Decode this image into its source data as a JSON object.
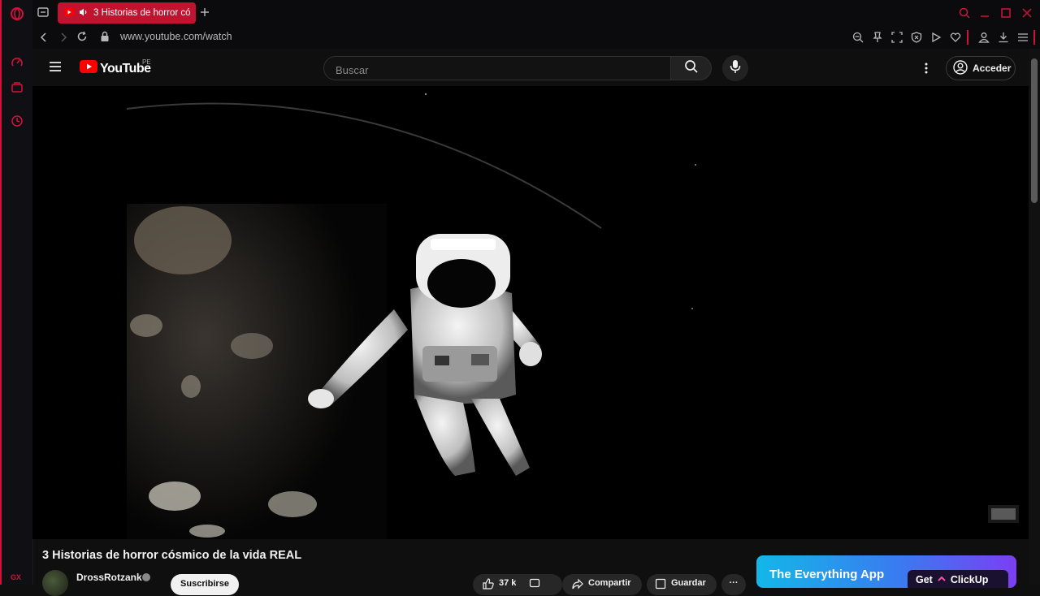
{
  "browser": {
    "tab_title": "3 Historias de horror có",
    "url": "www.youtube.com/watch",
    "brand": "GX",
    "accent_color": "#d1123a"
  },
  "header": {
    "logo_text": "YouTube",
    "region": "PE",
    "search_placeholder": "Buscar",
    "signin_label": "Acceder"
  },
  "video": {
    "title": "3 Historias de horror cósmico de la vida REAL",
    "channel": "DrossRotzank",
    "subscribe_label": "Suscribirse",
    "likes": "37 k",
    "share_label": "Compartir",
    "save_label": "Guardar",
    "more_label": "···"
  },
  "ad": {
    "headline": "The Everything App",
    "cta_prefix": "Get",
    "cta_brand": "ClickUp"
  },
  "icons": {
    "sidebar": [
      "speed-dial-icon",
      "bag-icon",
      "history-icon"
    ],
    "toolbar": [
      "zoom-icon",
      "pin-icon",
      "snapshot-icon",
      "shield-icon",
      "play-icon",
      "heart-icon",
      "account-icon",
      "download-icon",
      "menu-icon"
    ]
  }
}
